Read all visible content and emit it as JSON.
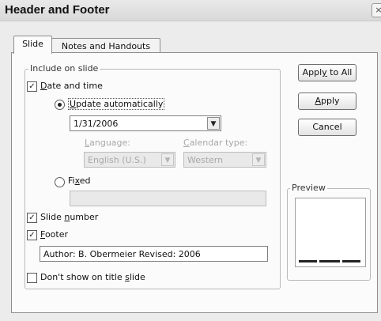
{
  "window": {
    "title": "Header and Footer",
    "close_glyph": "×"
  },
  "tabs": [
    {
      "label": "Slide",
      "active": true
    },
    {
      "label": "Notes and Handouts",
      "active": false
    }
  ],
  "include_group": {
    "legend": "Include on slide"
  },
  "date_time": {
    "label_mnemonic": "D",
    "label_rest": "ate and time",
    "checked": true,
    "update_auto": {
      "mnemonic": "U",
      "rest": "pdate automatically",
      "selected": true
    },
    "date_value": "1/31/2006",
    "language": {
      "label_mnemonic": "L",
      "label_rest": "anguage:",
      "value": "English (U.S.)"
    },
    "calendar": {
      "label_mnemonic": "C",
      "label_rest": "alendar type:",
      "value": "Western"
    },
    "fixed": {
      "pre": "Fi",
      "mnemonic": "x",
      "post": "ed",
      "selected": false,
      "value": ""
    }
  },
  "slide_number": {
    "pre": "Slide ",
    "mnemonic": "n",
    "post": "umber",
    "checked": true
  },
  "footer": {
    "mnemonic": "F",
    "rest": "ooter",
    "checked": true,
    "value": "Author: B. Obermeier Revised: 2006"
  },
  "dont_show": {
    "pre": "Don't show on title ",
    "mnemonic": "s",
    "post": "lide",
    "checked": false
  },
  "buttons": {
    "apply_all": {
      "pre": "Appl",
      "mnemonic": "y",
      "post": " to All"
    },
    "apply": {
      "mnemonic": "A",
      "post": "pply"
    },
    "cancel": "Cancel"
  },
  "preview": {
    "legend": "Preview"
  },
  "glyphs": {
    "check": "✓",
    "dropdown": "▼"
  },
  "icons": {
    "close": "close-icon",
    "checkmark": "checkmark-icon",
    "dropdown_arrow": "chevron-down-icon"
  }
}
